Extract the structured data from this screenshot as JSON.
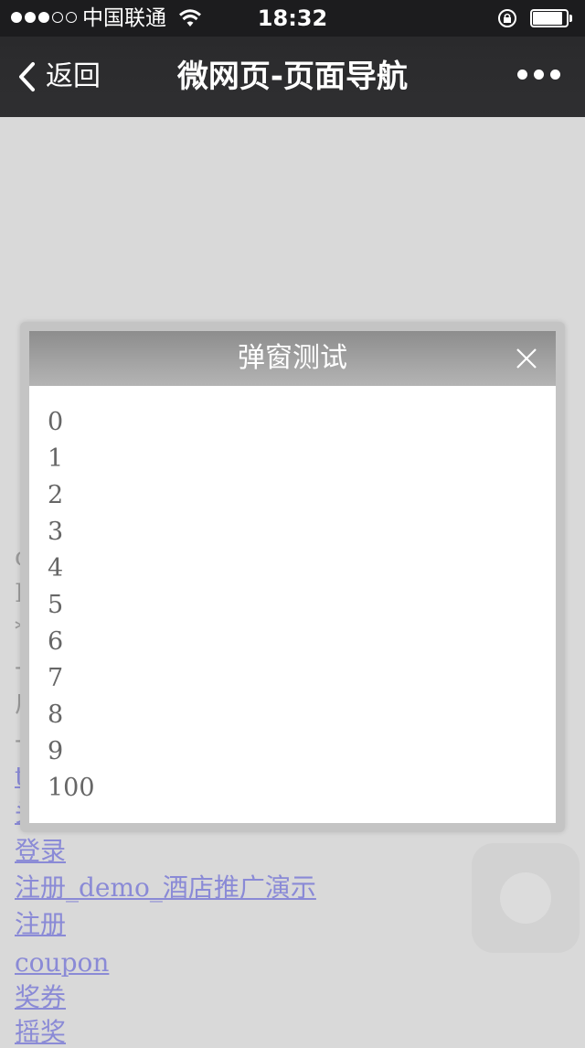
{
  "status_bar": {
    "carrier": "中国联通",
    "time": "18:32",
    "signal_bars_filled": 3,
    "signal_bars_total": 5,
    "battery_level": 0.8
  },
  "navbar": {
    "back_label": "返回",
    "title": "微网页-页面导航"
  },
  "background": {
    "fragments": [
      "c",
      "D",
      "*",
      "-",
      "广",
      "-",
      "t",
      "头"
    ],
    "links": [
      "登录",
      "注册_demo_酒店推广演示",
      "注册",
      "coupon",
      "奖券",
      "摇奖"
    ]
  },
  "modal": {
    "title": "弹窗测试",
    "items": [
      "0",
      "1",
      "2",
      "3",
      "4",
      "5",
      "6",
      "7",
      "8",
      "9",
      "100"
    ]
  },
  "colors": {
    "link": "#8a8ad6",
    "overlay_bg": "#d9d9d9",
    "navbar_bg": "#2d2d2f"
  }
}
